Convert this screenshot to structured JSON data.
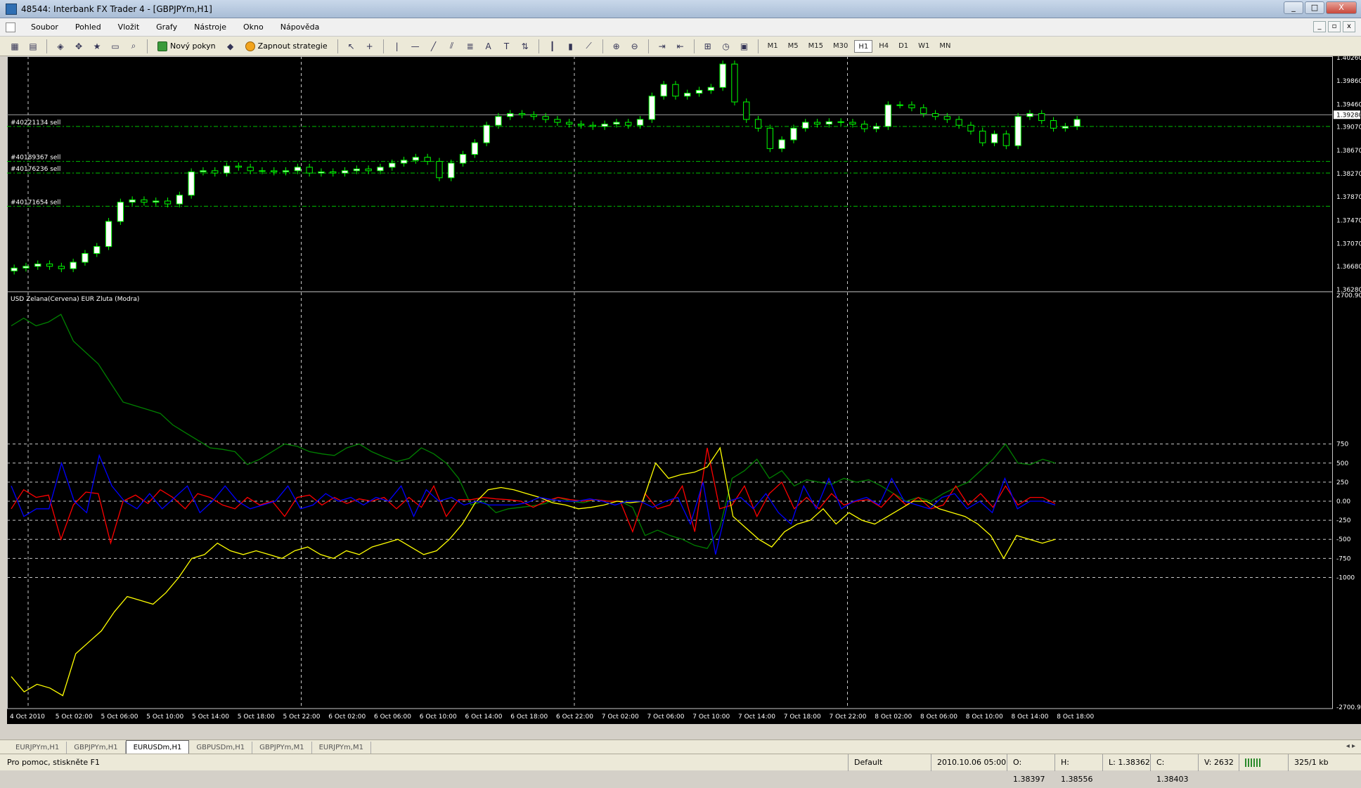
{
  "window": {
    "title": "48544: Interbank FX Trader 4 - [GBPJPYm,H1]",
    "buttons": [
      "_",
      "□",
      "X"
    ]
  },
  "menu": {
    "items": [
      "Soubor",
      "Pohled",
      "Vložit",
      "Grafy",
      "Nástroje",
      "Okno",
      "Nápověda"
    ],
    "mdi_buttons": [
      "_",
      "▫",
      "x"
    ]
  },
  "toolbar": {
    "new_order_label": "Nový pokyn",
    "strategy_label": "Zapnout strategie",
    "timeframes": [
      "M1",
      "M5",
      "M15",
      "M30",
      "H1",
      "H4",
      "D1",
      "W1",
      "MN"
    ],
    "active_timeframe": "H1",
    "icons": [
      "new-chart-icon",
      "profiles-icon",
      "market-watch-icon",
      "navigator-icon",
      "favorites-icon",
      "terminal-icon",
      "tester-icon",
      "cursor-icon",
      "crosshair-icon",
      "vertical-line-icon",
      "horizontal-line-icon",
      "trendline-icon",
      "channel-icon",
      "fibo-icon",
      "text-icon",
      "label-icon",
      "arrows-icon",
      "bar-chart-icon",
      "candle-chart-icon",
      "line-chart-icon",
      "zoom-in-icon",
      "zoom-out-icon",
      "autoscroll-icon",
      "chart-shift-icon",
      "indicators-icon",
      "periods-icon",
      "templates-icon"
    ]
  },
  "chart": {
    "price_axis": [
      "1.40260",
      "1.39860",
      "1.39460",
      "1.39280",
      "1.39070",
      "1.38670",
      "1.38270",
      "1.37870",
      "1.37470",
      "1.37070",
      "1.36680",
      "1.36280"
    ],
    "current_price": "1.39280",
    "order_lines": [
      {
        "label": "#40221134 sell",
        "price": 1.3908
      },
      {
        "label": "#40189367 sell",
        "price": 1.3848
      },
      {
        "label": "#40176236 sell",
        "price": 1.3828
      },
      {
        "label": "#40171654 sell",
        "price": 1.3771
      }
    ],
    "indicator_title": "USD Zelana(Cervena) EUR Zluta (Modra)",
    "indicator_axis": [
      "2700.907",
      "750",
      "500",
      "250",
      "0.00",
      "-250",
      "-500",
      "-750",
      "-1000",
      "-2700.90"
    ],
    "time_axis": [
      "4 Oct 2010",
      "5 Oct 02:00",
      "5 Oct 06:00",
      "5 Oct 10:00",
      "5 Oct 14:00",
      "5 Oct 18:00",
      "5 Oct 22:00",
      "6 Oct 02:00",
      "6 Oct 06:00",
      "6 Oct 10:00",
      "6 Oct 14:00",
      "6 Oct 18:00",
      "6 Oct 22:00",
      "7 Oct 02:00",
      "7 Oct 06:00",
      "7 Oct 10:00",
      "7 Oct 14:00",
      "7 Oct 18:00",
      "7 Oct 22:00",
      "8 Oct 02:00",
      "8 Oct 06:00",
      "8 Oct 10:00",
      "8 Oct 14:00",
      "8 Oct 18:00"
    ],
    "colors": {
      "bull": "#ffffff",
      "bear": "#000000",
      "wick": "#00ff00",
      "grid": "#c8c8c8",
      "order": "#00c000",
      "green": "#008000",
      "red": "#ff0000",
      "blue": "#0000ff",
      "yellow": "#ffff00"
    }
  },
  "chart_data": {
    "type": "line",
    "candles_close": [
      1.3665,
      1.3668,
      1.3672,
      1.3668,
      1.3664,
      1.3675,
      1.369,
      1.3702,
      1.3745,
      1.3778,
      1.3782,
      1.3778,
      1.378,
      1.3775,
      1.379,
      1.383,
      1.3832,
      1.3828,
      1.384,
      1.3838,
      1.3832,
      1.3832,
      1.383,
      1.3832,
      1.3838,
      1.3828,
      1.383,
      1.3828,
      1.3832,
      1.3835,
      1.3832,
      1.3838,
      1.3845,
      1.385,
      1.3855,
      1.3848,
      1.382,
      1.3845,
      1.386,
      1.388,
      1.391,
      1.3925,
      1.393,
      1.3928,
      1.3925,
      1.392,
      1.3915,
      1.3912,
      1.391,
      1.3908,
      1.3912,
      1.3915,
      1.391,
      1.392,
      1.396,
      1.398,
      1.396,
      1.3965,
      1.397,
      1.3975,
      1.4015,
      1.395,
      1.392,
      1.3905,
      1.387,
      1.3885,
      1.3905,
      1.3915,
      1.3912,
      1.3916,
      1.3915,
      1.3912,
      1.3904,
      1.3908,
      1.3945,
      1.3945,
      1.394,
      1.393,
      1.3925,
      1.392,
      1.391,
      1.39,
      1.388,
      1.3895,
      1.3875,
      1.3925,
      1.393,
      1.3918,
      1.3905,
      1.3908,
      1.392
    ],
    "series": [
      {
        "name": "USD Zelana",
        "values": [
          2300,
          2400,
          2300,
          2350,
          2450,
          2100,
          1950,
          1800,
          1550,
          1300,
          1250,
          1200,
          1150,
          1000,
          900,
          800,
          700,
          680,
          650,
          480,
          550,
          650,
          750,
          720,
          650,
          620,
          600,
          700,
          750,
          650,
          580,
          520,
          560,
          700,
          620,
          500,
          300,
          -50,
          0,
          -150,
          -100,
          -80,
          -60,
          -30,
          50,
          0,
          -20,
          20,
          0,
          0,
          -80,
          -450,
          -380,
          -450,
          -500,
          -580,
          -620,
          -350,
          300,
          400,
          550,
          300,
          400,
          200,
          280,
          250,
          220,
          300,
          250,
          280,
          200,
          100,
          0,
          50,
          0,
          100,
          180,
          250,
          400,
          550,
          750,
          500,
          480,
          550,
          500
        ]
      },
      {
        "name": "Cervena",
        "values": [
          -100,
          150,
          50,
          80,
          -500,
          -50,
          120,
          100,
          -550,
          0,
          80,
          -30,
          150,
          50,
          -100,
          100,
          50,
          -50,
          -100,
          50,
          -50,
          0,
          -200,
          50,
          80,
          -50,
          50,
          -30,
          30,
          0,
          50,
          -100,
          50,
          -80,
          200,
          -200,
          20,
          20,
          50,
          30,
          20,
          0,
          -80,
          0,
          50,
          20,
          0,
          20,
          0,
          0,
          -400,
          100,
          -100,
          -50,
          200,
          -400,
          700,
          -100,
          -50,
          200,
          -200,
          100,
          250,
          -100,
          50,
          -100,
          100,
          -50,
          0,
          20,
          -80,
          100,
          -50,
          50,
          -100,
          -50,
          200,
          -50,
          100,
          -80,
          200,
          -50,
          50,
          50,
          -30
        ]
      },
      {
        "name": "EUR Zluta",
        "values": [
          -2300,
          -2500,
          -2400,
          -2450,
          -2550,
          -2000,
          -1850,
          -1700,
          -1450,
          -1250,
          -1300,
          -1350,
          -1200,
          -1000,
          -750,
          -700,
          -550,
          -650,
          -700,
          -650,
          -700,
          -750,
          -650,
          -600,
          -700,
          -750,
          -650,
          -700,
          -600,
          -550,
          -500,
          -600,
          -700,
          -650,
          -500,
          -300,
          -20,
          150,
          180,
          150,
          100,
          50,
          -20,
          -50,
          -100,
          -80,
          -50,
          0,
          -20,
          0,
          500,
          300,
          350,
          380,
          450,
          700,
          -200,
          -350,
          -500,
          -600,
          -400,
          -300,
          -250,
          -100,
          -300,
          -150,
          -250,
          -300,
          -200,
          -100,
          0,
          0,
          -100,
          -150,
          -200,
          -300,
          -450,
          -750,
          -450,
          -500,
          -550,
          -500
        ]
      },
      {
        "name": "Modra",
        "values": [
          200,
          -200,
          -100,
          -100,
          500,
          0,
          -150,
          600,
          200,
          0,
          -100,
          100,
          -100,
          50,
          200,
          -150,
          0,
          200,
          0,
          -100,
          -50,
          0,
          200,
          -100,
          -50,
          100,
          0,
          50,
          -50,
          50,
          0,
          200,
          -200,
          150,
          0,
          50,
          -50,
          0,
          -50,
          -50,
          -50,
          -20,
          50,
          20,
          0,
          0,
          30,
          0,
          -50,
          0,
          0,
          -80,
          0,
          50,
          -300,
          250,
          -700,
          0,
          50,
          -100,
          100,
          -150,
          -300,
          200,
          -100,
          300,
          -100,
          0,
          50,
          -50,
          300,
          0,
          -50,
          -100,
          50,
          100,
          -100,
          0,
          -150,
          300,
          -100,
          0,
          0,
          -50
        ]
      }
    ],
    "ylim": [
      -2700.9,
      2700.907
    ]
  },
  "tabs": [
    "EURJPYm,H1",
    "GBPJPYm,H1",
    "EURUSDm,H1",
    "GBPUSDm,H1",
    "GBPJPYm,M1",
    "EURJPYm,M1"
  ],
  "active_tab": "EURUSDm,H1",
  "status": {
    "help": "Pro pomoc, stiskněte F1",
    "profile": "Default",
    "datetime": "2010.10.06 05:00",
    "open": "O: 1.38397",
    "high": "H: 1.38556",
    "low": "L: 1.38362",
    "close": "C: 1.38403",
    "volume": "V: 2632",
    "traffic": "325/1 kb"
  }
}
